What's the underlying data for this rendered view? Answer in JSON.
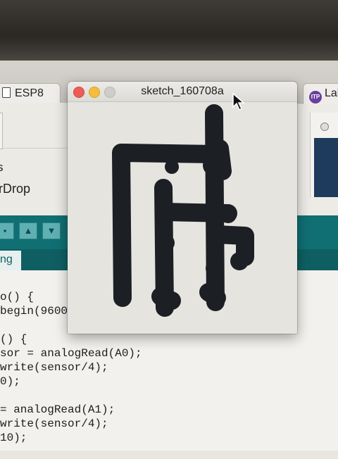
{
  "browser": {
    "tab_left_label": "ESP8",
    "tab_right_label": "Lal",
    "tab_right_icon_text": "ITP"
  },
  "ide": {
    "menu_fragment_1": "s",
    "menu_fragment_2": "rDrop",
    "toolbar_buttons": [
      "upload-icon",
      "open-icon",
      "save-icon"
    ],
    "active_tab_label": "ng",
    "code_lines": [
      "o() {",
      "begin(9600)",
      "",
      "() {",
      "sor = analogRead(A0);",
      "write(sensor/4);",
      "0);",
      "",
      "= analogRead(A1);",
      "write(sensor/4);",
      "10);"
    ]
  },
  "sketch_window": {
    "title": "sketch_160708a",
    "stroke_color": "#1c1f24",
    "canvas_color": "#e5e4df"
  },
  "colors": {
    "ide_teal": "#106f72",
    "close": "#ec5d55",
    "minimize": "#f4bd3b",
    "maximize_inactive": "#cfcdc9"
  }
}
